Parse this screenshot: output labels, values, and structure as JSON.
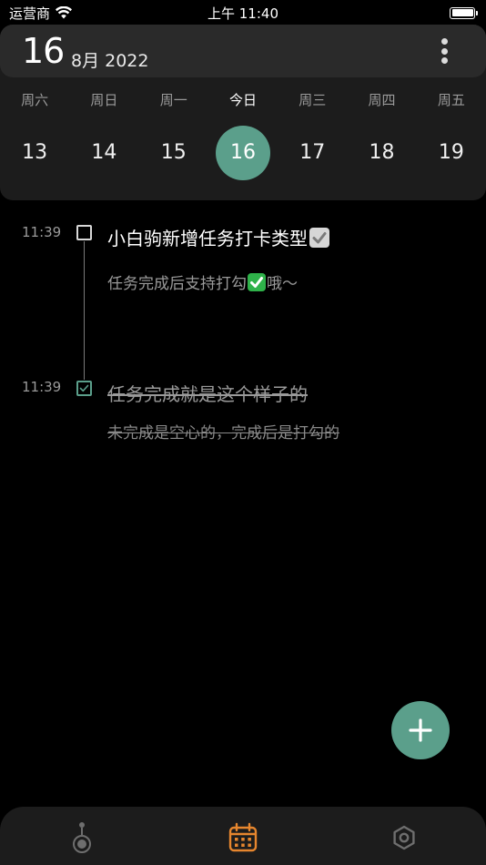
{
  "status_bar": {
    "carrier": "运营商",
    "time": "上午 11:40"
  },
  "header": {
    "day": "16",
    "month_year": "8月 2022"
  },
  "week": {
    "days": [
      {
        "label": "周六",
        "date": "13",
        "today": false,
        "selected": false
      },
      {
        "label": "周日",
        "date": "14",
        "today": false,
        "selected": false
      },
      {
        "label": "周一",
        "date": "15",
        "today": false,
        "selected": false
      },
      {
        "label": "今日",
        "date": "16",
        "today": true,
        "selected": true
      },
      {
        "label": "周三",
        "date": "17",
        "today": false,
        "selected": false
      },
      {
        "label": "周四",
        "date": "18",
        "today": false,
        "selected": false
      },
      {
        "label": "周五",
        "date": "19",
        "today": false,
        "selected": false
      }
    ]
  },
  "tasks": [
    {
      "time": "11:39",
      "title": "小白驹新增任务打卡类型",
      "desc_before": "任务完成后支持打勾",
      "desc_after": "哦～",
      "done": false
    },
    {
      "time": "11:39",
      "title": "任务完成就是这个样子的",
      "desc": "未完成是空心的，完成后是打勾的",
      "done": true
    }
  ],
  "colors": {
    "accent": "#5b9f8b",
    "tab_active": "#e6862e",
    "tab_inactive": "#6e6e6e"
  },
  "icons": {
    "fab": "plus-icon",
    "tab_1": "timeline-node-icon",
    "tab_2": "calendar-icon",
    "tab_3": "hexagon-settings-icon"
  }
}
